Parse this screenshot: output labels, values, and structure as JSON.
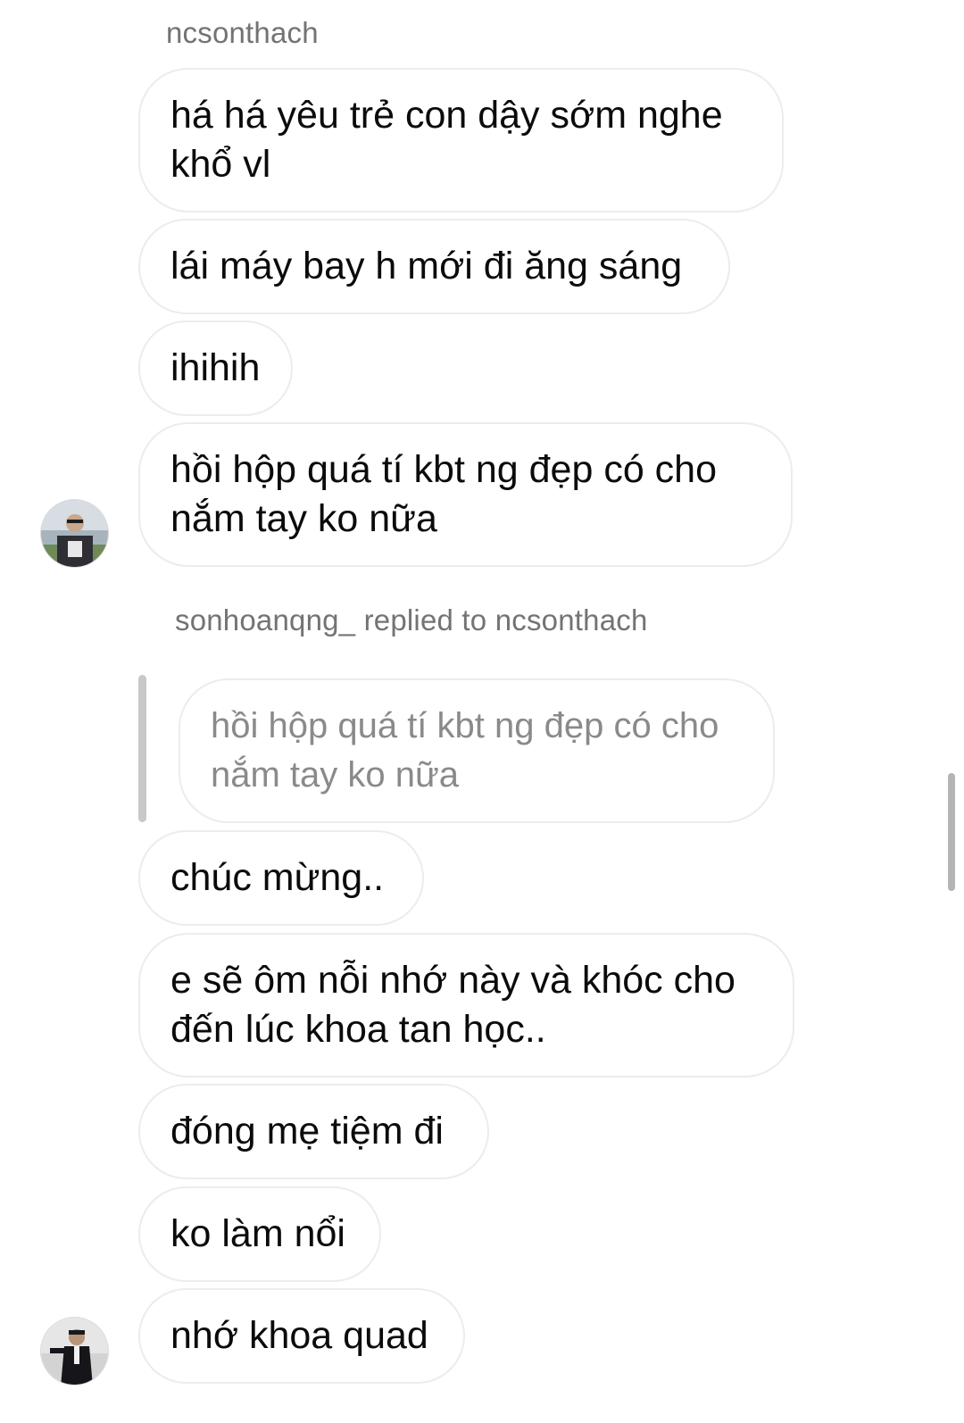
{
  "thread": {
    "group1": {
      "sender": "ncsonthach",
      "messages": [
        "há há yêu trẻ con dậy sớm nghe khổ vl",
        "lái máy bay h mới đi ăng sáng",
        "ihihih",
        "hồi hộp quá tí kbt ng đẹp có cho nắm tay ko nữa"
      ]
    },
    "reply": {
      "header": "sonhoanqng_ replied to ncsonthach",
      "quoted_text": "hồi hộp quá tí kbt ng đẹp có cho nắm tay ko nữa"
    },
    "group2": {
      "messages": [
        "chúc mừng..",
        "e sẽ ôm nỗi nhớ này và khóc cho đến lúc khoa tan học..",
        "đóng mẹ tiệm đi",
        "ko làm nổi",
        "nhớ khoa quad"
      ]
    }
  },
  "colors": {
    "bubble_border": "#ececec",
    "sender_text": "#737373",
    "quoted_text": "#8a8a8a",
    "quote_bar": "#c8c8c8"
  },
  "icons": [
    "avatar-ncsonthach",
    "avatar-sonhoanqng"
  ]
}
